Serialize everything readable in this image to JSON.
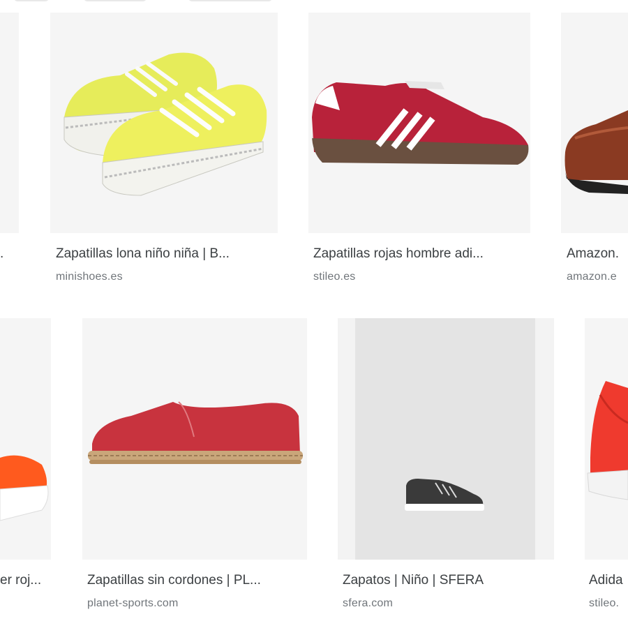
{
  "results": [
    {
      "id": "r1c0",
      "title": ".",
      "source": ""
    },
    {
      "id": "r1c1",
      "title": "Zapatillas lona niño niña | B...",
      "source": "minishoes.es"
    },
    {
      "id": "r1c2",
      "title": "Zapatillas rojas hombre adi...",
      "source": "stileo.es"
    },
    {
      "id": "r1c3",
      "title": "Amazon.",
      "source": "amazon.e"
    },
    {
      "id": "r2c0",
      "title": "er roj...",
      "source": ""
    },
    {
      "id": "r2c1",
      "title": "Zapatillas sin cordones | PL...",
      "source": "planet-sports.com"
    },
    {
      "id": "r2c2",
      "title": "Zapatos | Niño | SFERA",
      "source": "sfera.com"
    },
    {
      "id": "r2c3",
      "title": "Adida",
      "source": "stileo."
    }
  ],
  "icons": {
    "r1c1": "yellow-canvas-sneakers",
    "r1c2": "red-adidas-sneaker",
    "r1c3": "brown-leather-shoe",
    "r2c0": "orange-sneaker",
    "r2c1": "red-espadrille",
    "r2c2": "black-kids-sneaker",
    "r2c3": "red-adidas-sneaker"
  }
}
